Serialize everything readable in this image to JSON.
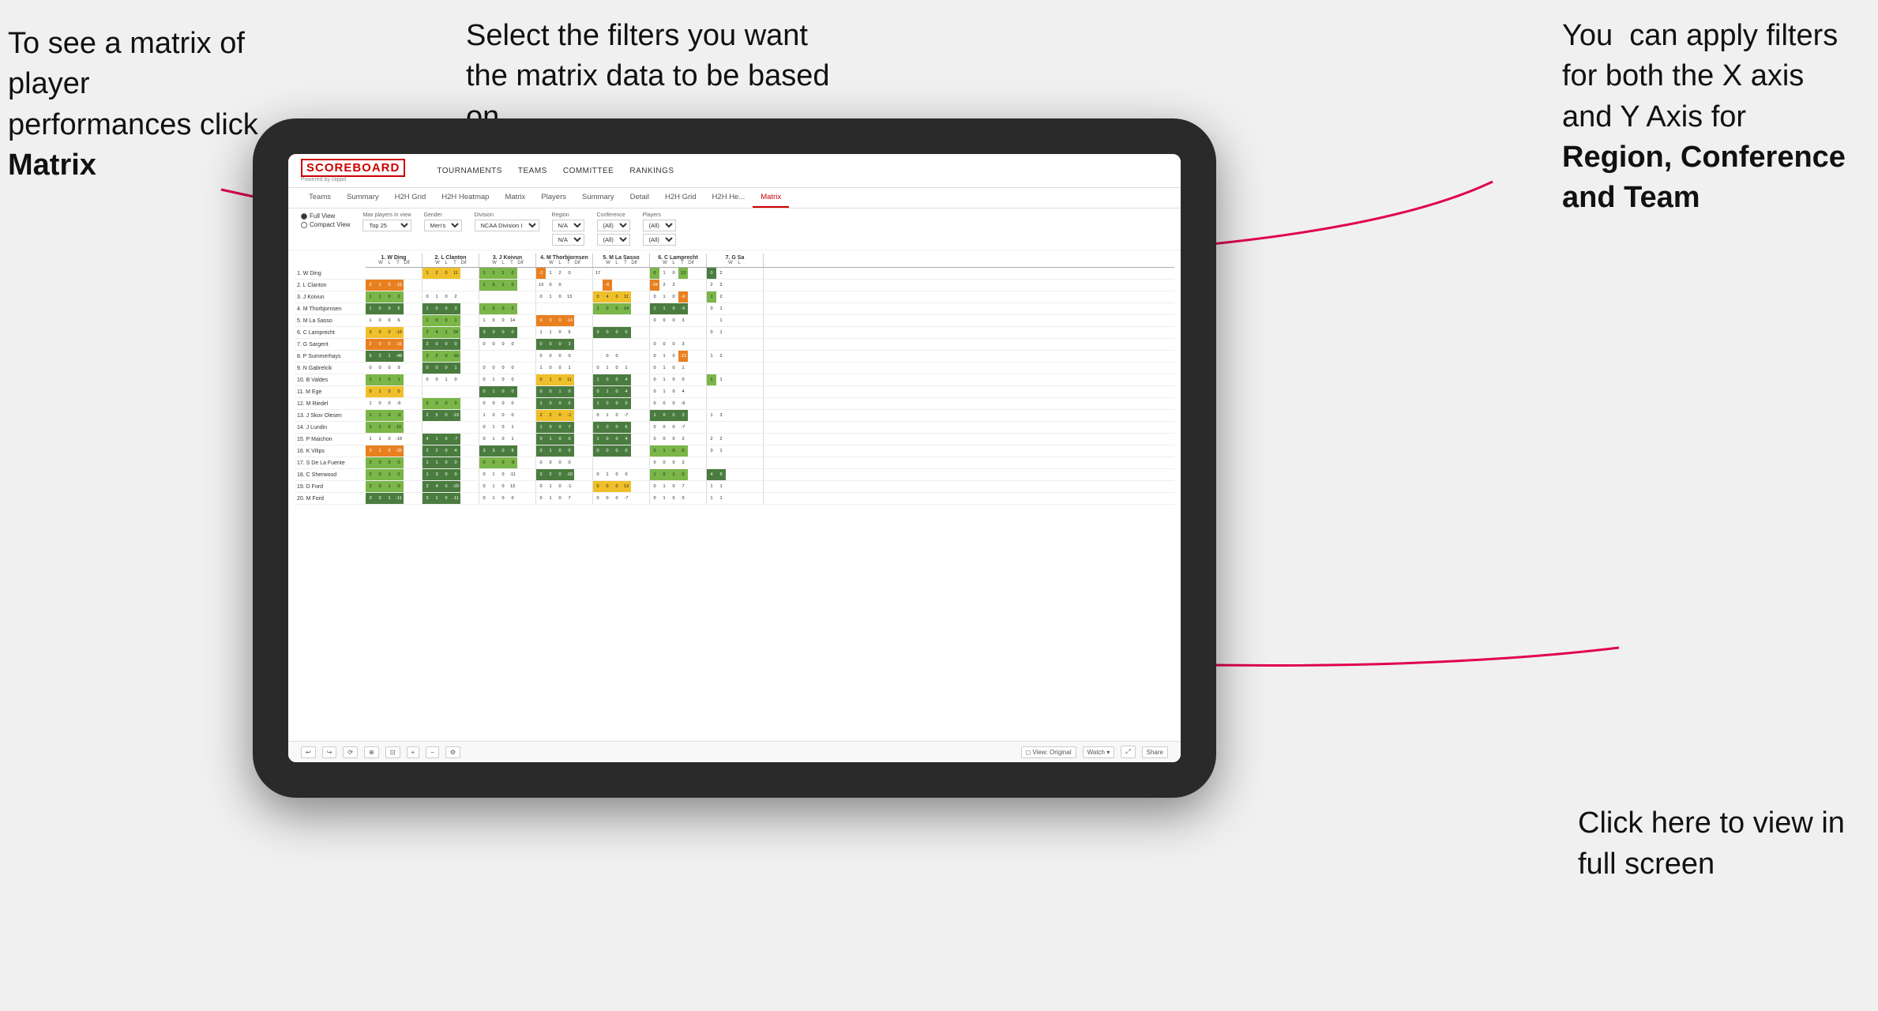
{
  "annotations": {
    "topleft": "To see a matrix of player performances click Matrix",
    "topleft_bold": "Matrix",
    "topmid": "Select the filters you want the matrix data to be based on",
    "topright_line1": "You  can apply filters for both the X axis and Y Axis for ",
    "topright_bold": "Region, Conference and Team",
    "bottomright_line1": "Click here to view in full screen"
  },
  "nav": {
    "brand": "SCOREBOARD",
    "powered": "Powered by clippd",
    "links": [
      "TOURNAMENTS",
      "TEAMS",
      "COMMITTEE",
      "RANKINGS"
    ]
  },
  "subtabs": {
    "players_tabs": [
      "Teams",
      "Summary",
      "H2H Grid",
      "H2H Heatmap",
      "Matrix",
      "Players",
      "Summary",
      "Detail",
      "H2H Grid",
      "H2H He...",
      "Matrix"
    ],
    "active": "Matrix"
  },
  "filters": {
    "view_options": [
      "Full View",
      "Compact View"
    ],
    "selected_view": "Full View",
    "max_players": {
      "label": "Max players in view",
      "value": "Top 25"
    },
    "gender": {
      "label": "Gender",
      "value": "Men's"
    },
    "division": {
      "label": "Division",
      "value": "NCAA Division I"
    },
    "region": {
      "label": "Region",
      "values": [
        "N/A",
        "N/A"
      ]
    },
    "conference": {
      "label": "Conference",
      "values": [
        "(All)",
        "(All)"
      ]
    },
    "players": {
      "label": "Players",
      "values": [
        "(All)",
        "(All)"
      ]
    }
  },
  "columns": [
    {
      "name": "1. W Ding",
      "headers": [
        "W",
        "L",
        "T",
        "Dif"
      ]
    },
    {
      "name": "2. L Clanton",
      "headers": [
        "W",
        "L",
        "T",
        "Dif"
      ]
    },
    {
      "name": "3. J Koivun",
      "headers": [
        "W",
        "L",
        "T",
        "Dif"
      ]
    },
    {
      "name": "4. M Thorbjornsen",
      "headers": [
        "W",
        "L",
        "T",
        "Dif"
      ]
    },
    {
      "name": "5. M La Sasso",
      "headers": [
        "W",
        "L",
        "T",
        "Dif"
      ]
    },
    {
      "name": "6. C Lamprecht",
      "headers": [
        "W",
        "L",
        "T",
        "Dif"
      ]
    },
    {
      "name": "7. G Sa",
      "headers": [
        "W",
        "L"
      ]
    }
  ],
  "rows": [
    {
      "label": "1. W Ding"
    },
    {
      "label": "2. L Clanton"
    },
    {
      "label": "3. J Koivun"
    },
    {
      "label": "4. M Thorbjornsen"
    },
    {
      "label": "5. M La Sasso"
    },
    {
      "label": "6. C Lamprecht"
    },
    {
      "label": "7. G Sargent"
    },
    {
      "label": "8. P Summerhays"
    },
    {
      "label": "9. N Gabrelcik"
    },
    {
      "label": "10. B Valdes"
    },
    {
      "label": "11. M Ege"
    },
    {
      "label": "12. M Riedel"
    },
    {
      "label": "13. J Skov Olesen"
    },
    {
      "label": "14. J Lundin"
    },
    {
      "label": "15. P Maichon"
    },
    {
      "label": "16. K Vilips"
    },
    {
      "label": "17. S De La Fuente"
    },
    {
      "label": "18. C Sherwood"
    },
    {
      "label": "19. D Ford"
    },
    {
      "label": "20. M Ford"
    }
  ],
  "toolbar": {
    "left_items": [
      "↩",
      "↪",
      "⟳",
      "⊕",
      "⊡",
      "+",
      "-",
      "⚙"
    ],
    "view_label": "View: Original",
    "watch_label": "Watch ▾",
    "share_label": "Share"
  }
}
